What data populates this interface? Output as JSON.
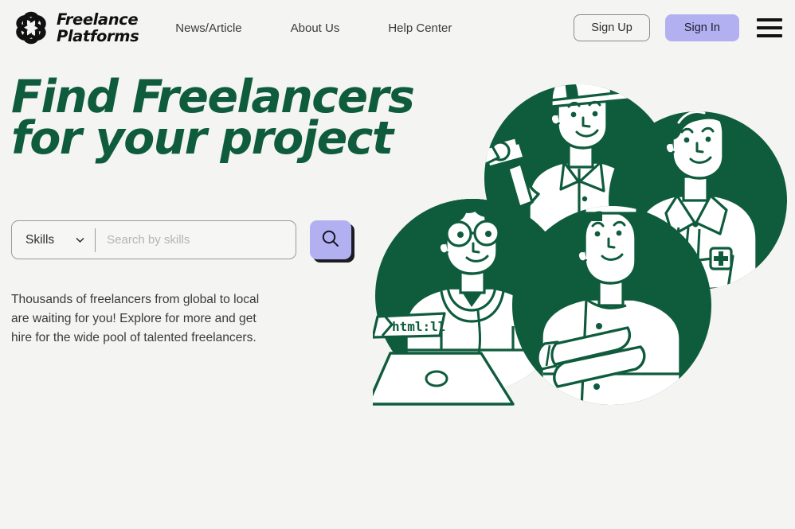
{
  "brand": {
    "name_line1": "Freelance",
    "name_line2": "Platforms",
    "full_name": "Freelance\nPlatforms",
    "logo_icon": "swirl-flower-logo-icon"
  },
  "nav": {
    "links": [
      {
        "label": "News/Article"
      },
      {
        "label": "About Us"
      },
      {
        "label": "Help Center"
      }
    ],
    "sign_up_label": "Sign Up",
    "sign_in_label": "Sign In",
    "menu_icon": "hamburger-menu-icon"
  },
  "hero": {
    "title_line1": "Find Freelancers",
    "title_line2": "for your project",
    "title": "Find Freelancers\nfor your project",
    "subtext_line1": "Thousands of freelancers from global to local",
    "subtext_line2": "are waiting for you! Explore for more and get",
    "subtext_line3": "hire for the wide pool of talented freelancers.",
    "subtext": "Thousands of freelancers from global to local\nare waiting for you! Explore for more and get\nhire for the wide pool of talented freelancers."
  },
  "search": {
    "category_selected": "Skills",
    "category_options": [
      "Skills"
    ],
    "input_value": "",
    "input_placeholder": "Search by skills",
    "submit_icon": "magnifying-glass-icon",
    "dropdown_icon": "chevron-down-icon"
  },
  "illustration": {
    "alt": "four freelancers in green circles",
    "code_tag_text": "html:ll",
    "figures": [
      {
        "name": "photographer-with-cap"
      },
      {
        "name": "doctor-with-medical-cross"
      },
      {
        "name": "developer-with-laptop"
      },
      {
        "name": "chef-with-toque"
      }
    ]
  },
  "colors": {
    "background": "#f4f4f3",
    "brand_green": "#0f5c3d",
    "accent_purple": "#b3b0f2",
    "text_dark": "#2f2f2f",
    "shadow_dark": "#1b1b24"
  }
}
